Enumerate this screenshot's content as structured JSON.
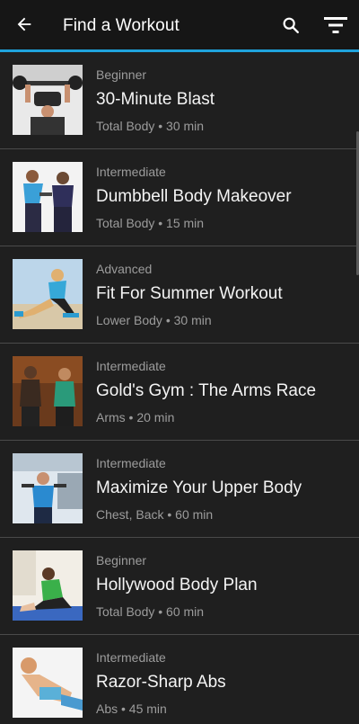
{
  "header": {
    "title": "Find a Workout",
    "back_icon": "arrow-left-icon",
    "search_icon": "search-icon",
    "filter_icon": "filter-icon"
  },
  "colors": {
    "accent": "#1fa3dc",
    "background": "#1f1f1f",
    "header_background": "#161616"
  },
  "workouts": [
    {
      "level": "Beginner",
      "name": "30-Minute Blast",
      "meta": "Total Body • 30 min"
    },
    {
      "level": "Intermediate",
      "name": "Dumbbell Body Makeover",
      "meta": "Total Body • 15 min"
    },
    {
      "level": "Advanced",
      "name": "Fit For Summer Workout",
      "meta": "Lower Body • 30 min"
    },
    {
      "level": "Intermediate",
      "name": "Gold's Gym : The Arms Race",
      "meta": "Arms • 20 min"
    },
    {
      "level": "Intermediate",
      "name": "Maximize Your Upper Body",
      "meta": "Chest, Back • 60 min"
    },
    {
      "level": "Beginner",
      "name": "Hollywood Body Plan",
      "meta": "Total Body • 60 min"
    },
    {
      "level": "Intermediate",
      "name": "Razor-Sharp Abs",
      "meta": "Abs • 45 min"
    }
  ]
}
